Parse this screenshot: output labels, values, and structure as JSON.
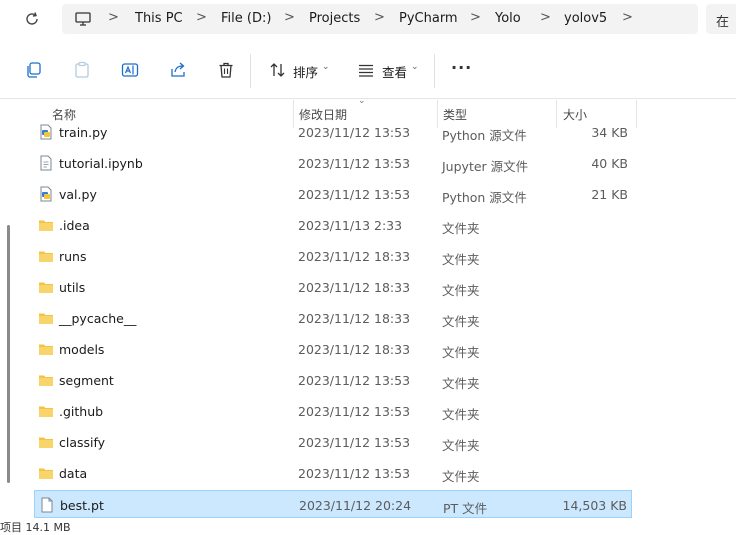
{
  "address": {
    "breadcrumbs": [
      "This PC",
      "File (D:)",
      "Projects",
      "PyCharm",
      "Yolo",
      "yolov5"
    ],
    "search_label": "在"
  },
  "toolbar": {
    "sort_label": "排序",
    "view_label": "查看",
    "more_label": "···"
  },
  "columns": {
    "name": "名称",
    "date": "修改日期",
    "type": "类型",
    "size": "大小"
  },
  "rows": [
    {
      "name": "train.py",
      "date": "2023/11/12 13:53",
      "type": "Python 源文件",
      "size": "34 KB",
      "icon": "python-file"
    },
    {
      "name": "tutorial.ipynb",
      "date": "2023/11/12 13:53",
      "type": "Jupyter 源文件",
      "size": "40 KB",
      "icon": "notebook-file"
    },
    {
      "name": "val.py",
      "date": "2023/11/12 13:53",
      "type": "Python 源文件",
      "size": "21 KB",
      "icon": "python-file"
    },
    {
      "name": ".idea",
      "date": "2023/11/13 2:33",
      "type": "文件夹",
      "size": "",
      "icon": "folder"
    },
    {
      "name": "runs",
      "date": "2023/11/12 18:33",
      "type": "文件夹",
      "size": "",
      "icon": "folder"
    },
    {
      "name": "utils",
      "date": "2023/11/12 18:33",
      "type": "文件夹",
      "size": "",
      "icon": "folder"
    },
    {
      "name": "__pycache__",
      "date": "2023/11/12 18:33",
      "type": "文件夹",
      "size": "",
      "icon": "folder"
    },
    {
      "name": "models",
      "date": "2023/11/12 18:33",
      "type": "文件夹",
      "size": "",
      "icon": "folder"
    },
    {
      "name": "segment",
      "date": "2023/11/12 13:53",
      "type": "文件夹",
      "size": "",
      "icon": "folder"
    },
    {
      "name": ".github",
      "date": "2023/11/12 13:53",
      "type": "文件夹",
      "size": "",
      "icon": "folder"
    },
    {
      "name": "classify",
      "date": "2023/11/12 13:53",
      "type": "文件夹",
      "size": "",
      "icon": "folder"
    },
    {
      "name": "data",
      "date": "2023/11/12 13:53",
      "type": "文件夹",
      "size": "",
      "icon": "folder"
    },
    {
      "name": "best.pt",
      "date": "2023/11/12 20:24",
      "type": "PT 文件",
      "size": "14,503 KB",
      "icon": "generic-file",
      "selected": true
    }
  ],
  "status_text": "项目 14.1 MB",
  "colors": {
    "folder": "#f5c342",
    "selection": "#cce8ff",
    "selection_border": "#99d1ff"
  }
}
